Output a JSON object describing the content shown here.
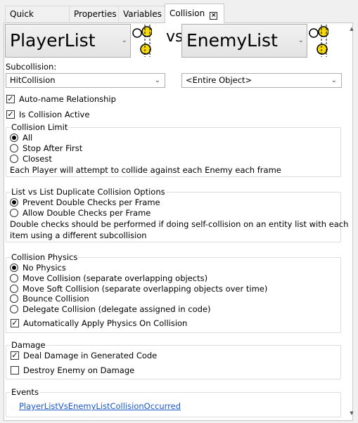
{
  "tabs": [
    {
      "label": "Quick Actions"
    },
    {
      "label": "Properties"
    },
    {
      "label": "Variables"
    },
    {
      "label": "Collision",
      "active": true
    }
  ],
  "tab_close_symbol": "×",
  "relationship": {
    "first_list": "PlayerList",
    "vs_label": "vs",
    "second_list": "EnemyList"
  },
  "subcollision": {
    "label": "Subcollision:",
    "first_value": "HitCollision",
    "second_value": "<Entire Object>"
  },
  "options": {
    "auto_name": {
      "label": "Auto-name Relationship",
      "checked": true
    },
    "is_active": {
      "label": "Is Collision Active",
      "checked": true
    }
  },
  "collision_limit": {
    "title": "Collision Limit",
    "options": [
      "All",
      "Stop After First",
      "Closest"
    ],
    "selected": "All",
    "description": "Each Player will attempt to collide against each Enemy each frame"
  },
  "duplicate_options": {
    "title": "List vs List Duplicate Collision Options",
    "options": [
      "Prevent Double Checks per Frame",
      "Allow Double Checks per Frame"
    ],
    "selected": "Prevent Double Checks per Frame",
    "description_line1": "Double checks should be performed if doing self-collision on an entity list with each",
    "description_line2": "item using a different subcollision"
  },
  "physics": {
    "title": "Collision Physics",
    "options": [
      "No Physics",
      "Move Collision (separate overlapping objects)",
      "Move Soft Collision (separate overlapping objects over time)",
      "Bounce Collision",
      "Delegate Collision (delegate assigned in code)"
    ],
    "selected": "No Physics",
    "auto_apply": {
      "label": "Automatically Apply Physics On Collision",
      "checked": true
    }
  },
  "damage": {
    "title": "Damage",
    "deal_damage": {
      "label": "Deal Damage in Generated Code",
      "checked": true
    },
    "destroy_enemy": {
      "label": "Destroy Enemy on Damage",
      "checked": false
    }
  },
  "events": {
    "title": "Events",
    "link": "PlayerListVsEnemyListCollisionOccurred"
  },
  "colors": {
    "link": "#1a58c8",
    "icon_fill": "#f5d90a"
  },
  "icons": {
    "collision_icon": "collision-circles-icon",
    "dropdown": "chevron-down-icon",
    "check": "checkmark-icon",
    "check_glyph": "✓",
    "chevron_glyph": "⌄",
    "scroll_up_glyph": "▲",
    "scroll_down_glyph": "▼"
  }
}
